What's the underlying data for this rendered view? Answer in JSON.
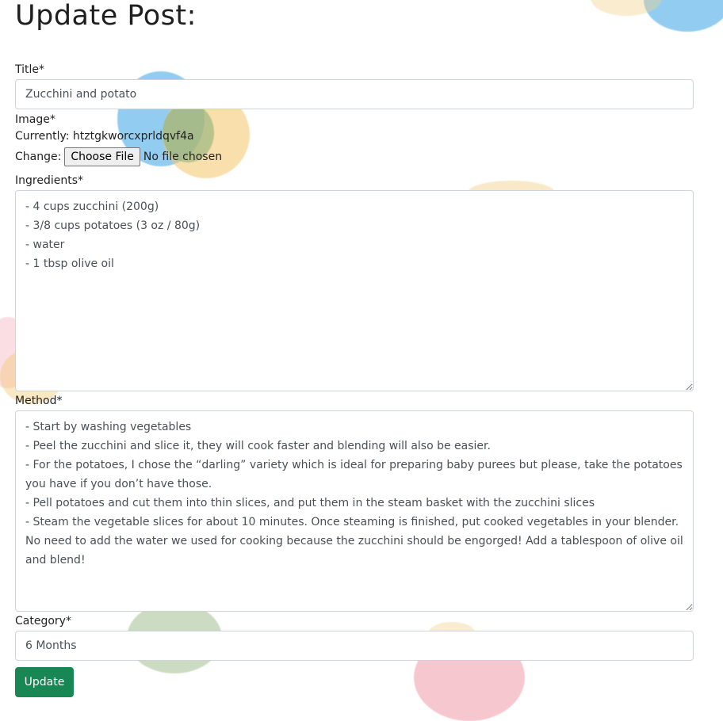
{
  "page": {
    "title": "Update Post:"
  },
  "form": {
    "title_label": "Title*",
    "title_value": "Zucchini and potato",
    "image_label": "Image*",
    "currently_label": "Currently:",
    "currently_value": "htztgkworcxprldqvf4a",
    "change_label": "Change:",
    "choose_file_label": "Choose File",
    "no_file_text": "No file chosen",
    "ingredients_label": "Ingredients*",
    "ingredients_value": "- 4 cups zucchini (200g)\n- 3/8 cups potatoes (3 oz / 80g)\n- water\n- 1 tbsp olive oil",
    "method_label": "Method*",
    "method_value": "- Start by washing vegetables\n- Peel the zucchini and slice it, they will cook faster and blending will also be easier.\n- For the potatoes, I chose the “darling” variety which is ideal for preparing baby purees but please, take the potatoes you have if you don’t have those.\n- Pell potatoes and cut them into thin slices, and put them in the steam basket with the zucchini slices\n- Steam the vegetable slices for about 10 minutes. Once steaming is finished, put cooked vegetables in your blender. No need to add the water we used for cooking because the zucchini should be engorged! Add a tablespoon of olive oil and blend!",
    "category_label": "Category*",
    "category_value": "6 Months",
    "update_label": "Update"
  },
  "colors": {
    "button_bg": "#198754",
    "input_border": "#ced4da",
    "watercolor_blue": "#3aa6e6",
    "watercolor_yellow": "#f4c66a",
    "watercolor_green": "#8fb27a",
    "watercolor_pink": "#f2a3b0"
  }
}
